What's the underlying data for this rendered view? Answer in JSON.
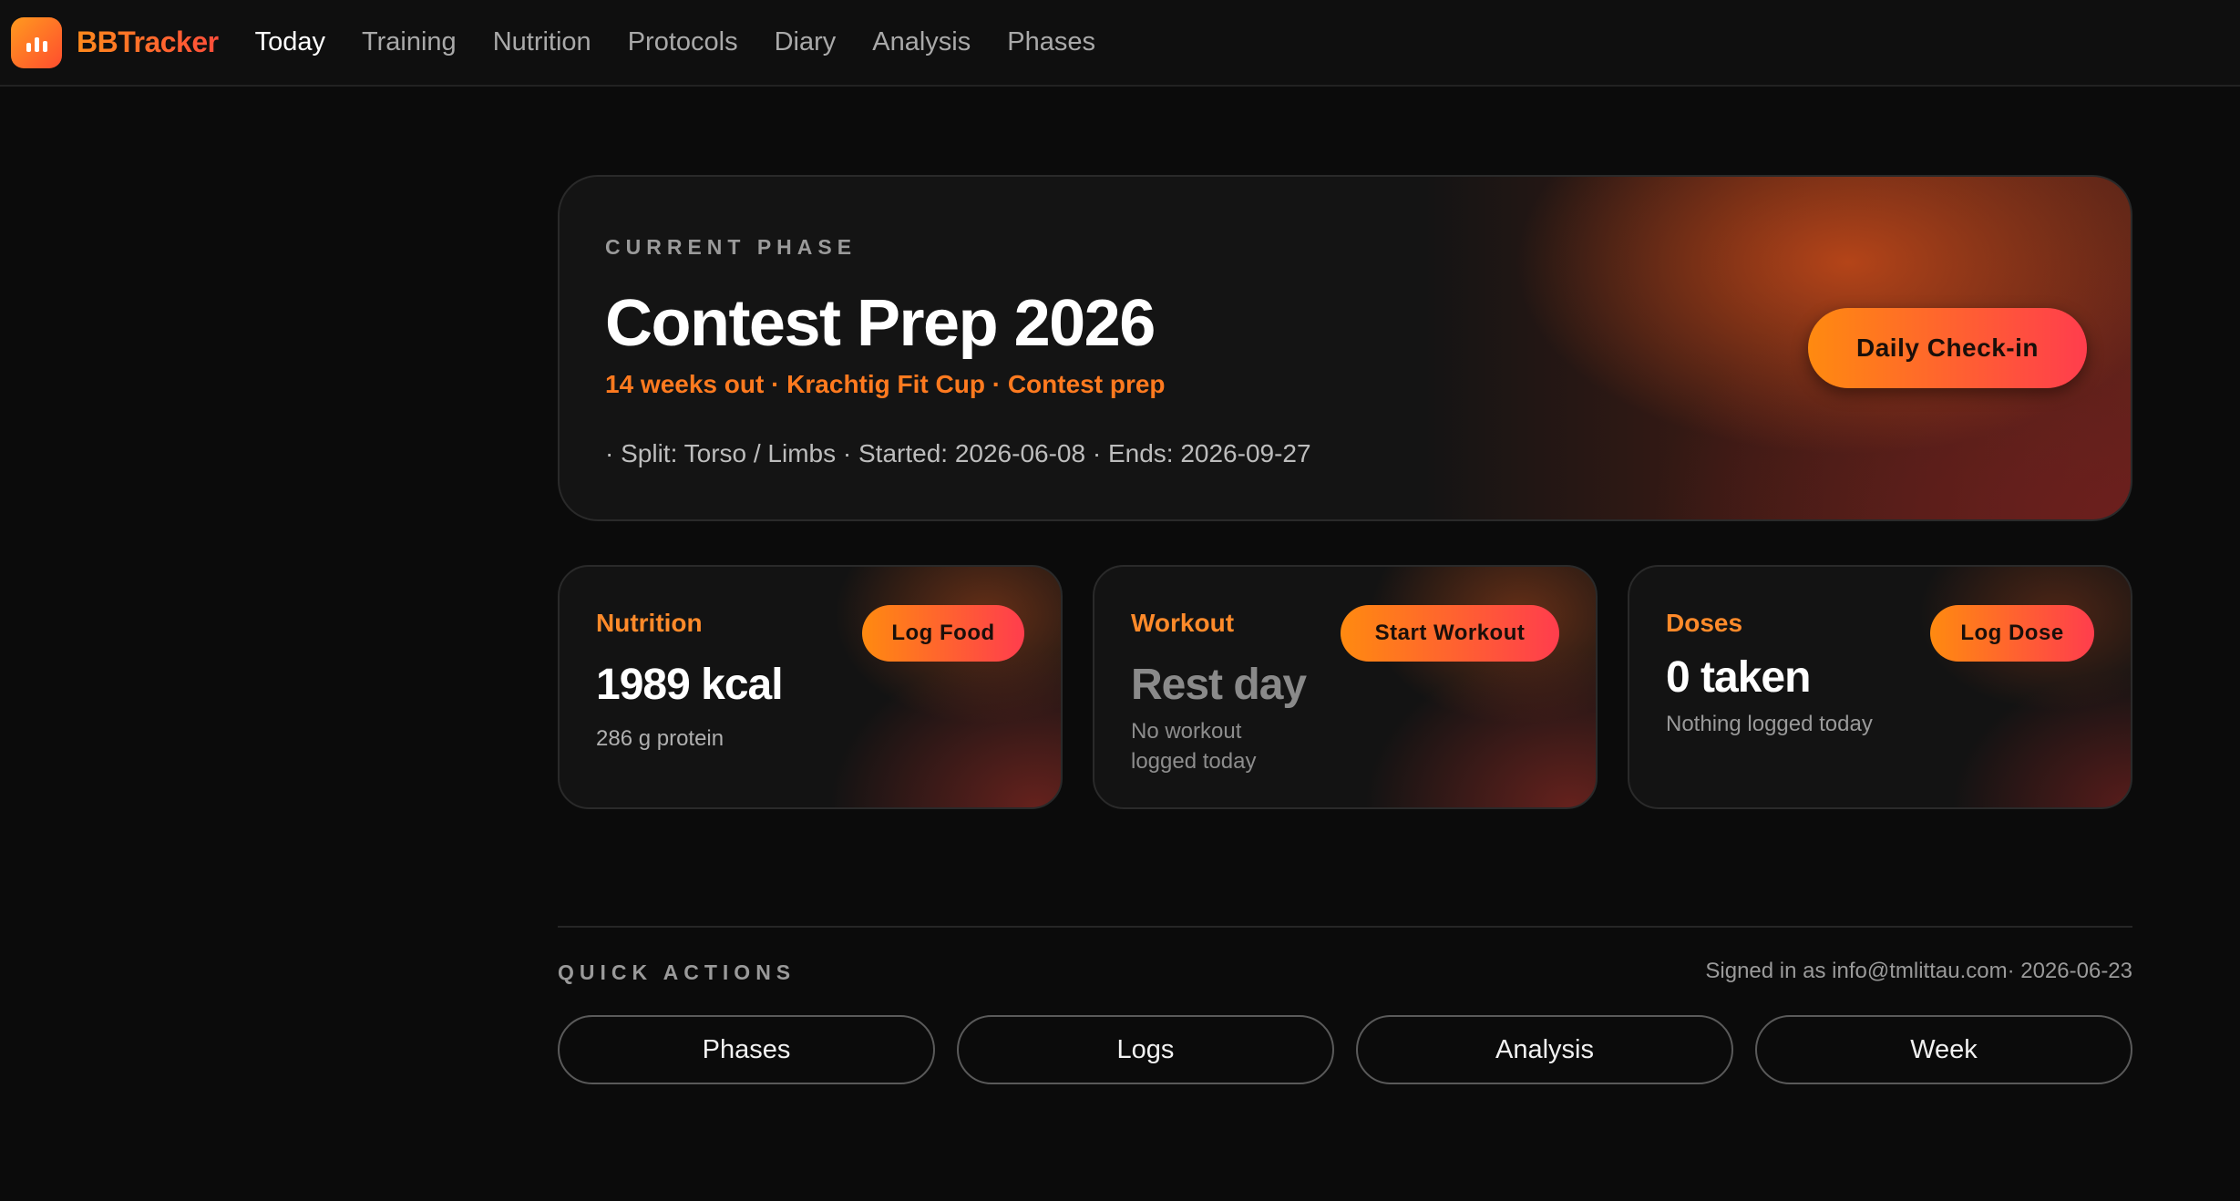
{
  "app": {
    "name": "BBTracker"
  },
  "nav": {
    "items": [
      {
        "label": "Today"
      },
      {
        "label": "Training"
      },
      {
        "label": "Nutrition"
      },
      {
        "label": "Protocols"
      },
      {
        "label": "Diary"
      },
      {
        "label": "Analysis"
      },
      {
        "label": "Phases"
      }
    ],
    "active": "Today"
  },
  "phase": {
    "label": "CURRENT PHASE",
    "title": "Contest Prep 2026",
    "subtitle": "14 weeks out · Krachtig Fit Cup · Contest prep",
    "meta": "· Split: Torso / Limbs · Started: 2026-06-08 · Ends: 2026-09-27",
    "checkin_label": "Daily Check-in"
  },
  "cards": {
    "nutrition": {
      "label": "Nutrition",
      "value": "1989 kcal",
      "sub": "286 g protein",
      "button": "Log Food"
    },
    "workout": {
      "label": "Workout",
      "value": "Rest day",
      "sub": "No workout logged today",
      "button": "Start Workout"
    },
    "doses": {
      "label": "Doses",
      "value": "0 taken",
      "sub": "Nothing logged today",
      "button": "Log Dose"
    }
  },
  "quick_actions": {
    "label": "QUICK ACTIONS",
    "signed_in": "Signed in as info@tmlittau.com· 2026-06-23",
    "buttons": [
      {
        "label": "Phases"
      },
      {
        "label": "Logs"
      },
      {
        "label": "Analysis"
      },
      {
        "label": "Week"
      }
    ]
  },
  "colors": {
    "accent": "#ff8a10",
    "accent_end": "#ff3d4d",
    "background": "#0b0b0b"
  },
  "icons": {
    "logo": "bar-chart-icon"
  }
}
